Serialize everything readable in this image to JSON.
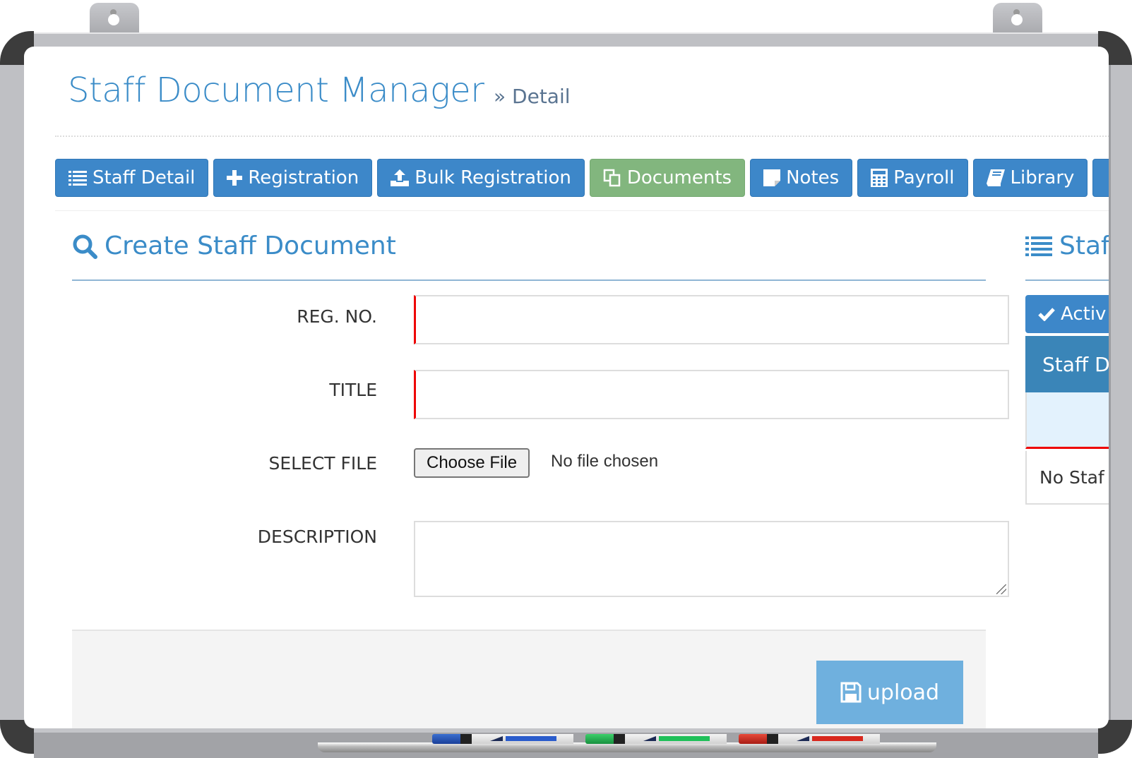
{
  "header": {
    "title": "Staff Document Manager",
    "breadcrumb": "» Detail"
  },
  "tabs": [
    {
      "label": "Staff Detail",
      "icon": "list-icon",
      "active": false
    },
    {
      "label": "Registration",
      "icon": "plus-icon",
      "active": false
    },
    {
      "label": "Bulk Registration",
      "icon": "upload-icon",
      "active": false
    },
    {
      "label": "Documents",
      "icon": "copy-icon",
      "active": true
    },
    {
      "label": "Notes",
      "icon": "sticky-note-icon",
      "active": false
    },
    {
      "label": "Payroll",
      "icon": "calculator-icon",
      "active": false
    },
    {
      "label": "Library",
      "icon": "book-icon",
      "active": false
    }
  ],
  "form": {
    "title": "Create Staff Document",
    "fields": {
      "reg_no": {
        "label": "REG. NO.",
        "value": ""
      },
      "title": {
        "label": "TITLE",
        "value": ""
      },
      "file": {
        "label": "SELECT FILE",
        "button": "Choose File",
        "status": "No file chosen"
      },
      "description": {
        "label": "DESCRIPTION",
        "value": ""
      }
    },
    "submit_label": "upload"
  },
  "side_panel": {
    "title": "Staf",
    "active_button": "Activ",
    "table_header": "Staff D",
    "empty_text": "No Staf"
  },
  "colors": {
    "primary": "#3d87c9",
    "active_tab": "#82b67e",
    "required_marker": "#e00000",
    "upload_button": "#6fb0de"
  }
}
